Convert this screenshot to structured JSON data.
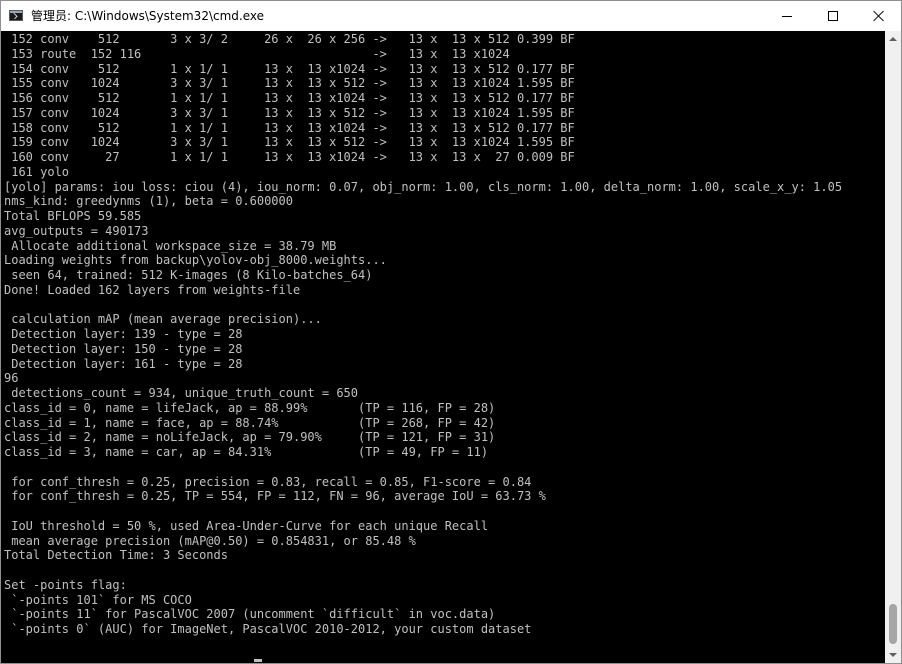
{
  "window": {
    "title": "管理员: C:\\Windows\\System32\\cmd.exe",
    "icon": "cmd-icon",
    "controls": {
      "minimize_icon": "minimize-icon",
      "maximize_icon": "maximize-icon",
      "close_icon": "close-icon"
    }
  },
  "colors": {
    "console_background": "#000000",
    "console_text": "#c0c0c0",
    "titlebar_background": "#ffffff",
    "scrollbar_track": "#f0f0f0",
    "scrollbar_thumb": "#a6a6a6"
  },
  "console": {
    "lines": [
      " 152 conv    512       3 x 3/ 2     26 x  26 x 256 ->   13 x  13 x 512 0.399 BF",
      " 153 route  152 116                                ->   13 x  13 x1024",
      " 154 conv    512       1 x 1/ 1     13 x  13 x1024 ->   13 x  13 x 512 0.177 BF",
      " 155 conv   1024       3 x 3/ 1     13 x  13 x 512 ->   13 x  13 x1024 1.595 BF",
      " 156 conv    512       1 x 1/ 1     13 x  13 x1024 ->   13 x  13 x 512 0.177 BF",
      " 157 conv   1024       3 x 3/ 1     13 x  13 x 512 ->   13 x  13 x1024 1.595 BF",
      " 158 conv    512       1 x 1/ 1     13 x  13 x1024 ->   13 x  13 x 512 0.177 BF",
      " 159 conv   1024       3 x 3/ 1     13 x  13 x 512 ->   13 x  13 x1024 1.595 BF",
      " 160 conv     27       1 x 1/ 1     13 x  13 x1024 ->   13 x  13 x  27 0.009 BF",
      " 161 yolo",
      "[yolo] params: iou loss: ciou (4), iou_norm: 0.07, obj_norm: 1.00, cls_norm: 1.00, delta_norm: 1.00, scale_x_y: 1.05",
      "nms_kind: greedynms (1), beta = 0.600000",
      "Total BFLOPS 59.585",
      "avg_outputs = 490173",
      " Allocate additional workspace_size = 38.79 MB",
      "Loading weights from backup\\yolov-obj_8000.weights...",
      " seen 64, trained: 512 K-images (8 Kilo-batches_64)",
      "Done! Loaded 162 layers from weights-file",
      "",
      " calculation mAP (mean average precision)...",
      " Detection layer: 139 - type = 28",
      " Detection layer: 150 - type = 28",
      " Detection layer: 161 - type = 28",
      "96",
      " detections_count = 934, unique_truth_count = 650",
      "class_id = 0, name = lifeJack, ap = 88.99%       (TP = 116, FP = 28)",
      "class_id = 1, name = face, ap = 88.74%           (TP = 268, FP = 42)",
      "class_id = 2, name = noLifeJack, ap = 79.90%     (TP = 121, FP = 31)",
      "class_id = 3, name = car, ap = 84.31%            (TP = 49, FP = 11)",
      "",
      " for conf_thresh = 0.25, precision = 0.83, recall = 0.85, F1-score = 0.84",
      " for conf_thresh = 0.25, TP = 554, FP = 112, FN = 96, average IoU = 63.73 %",
      "",
      " IoU threshold = 50 %, used Area-Under-Curve for each unique Recall",
      " mean average precision (mAP@0.50) = 0.854831, or 85.48 %",
      "Total Detection Time: 3 Seconds",
      "",
      "Set -points flag:",
      " `-points 101` for MS COCO",
      " `-points 11` for PascalVOC 2007 (uncomment `difficult` in voc.data)",
      " `-points 0` (AUC) for ImageNet, PascalVOC 2010-2012, your custom dataset"
    ]
  },
  "scrollbar": {
    "up_icon": "scroll-up-arrow-icon",
    "down_icon": "scroll-down-arrow-icon"
  }
}
